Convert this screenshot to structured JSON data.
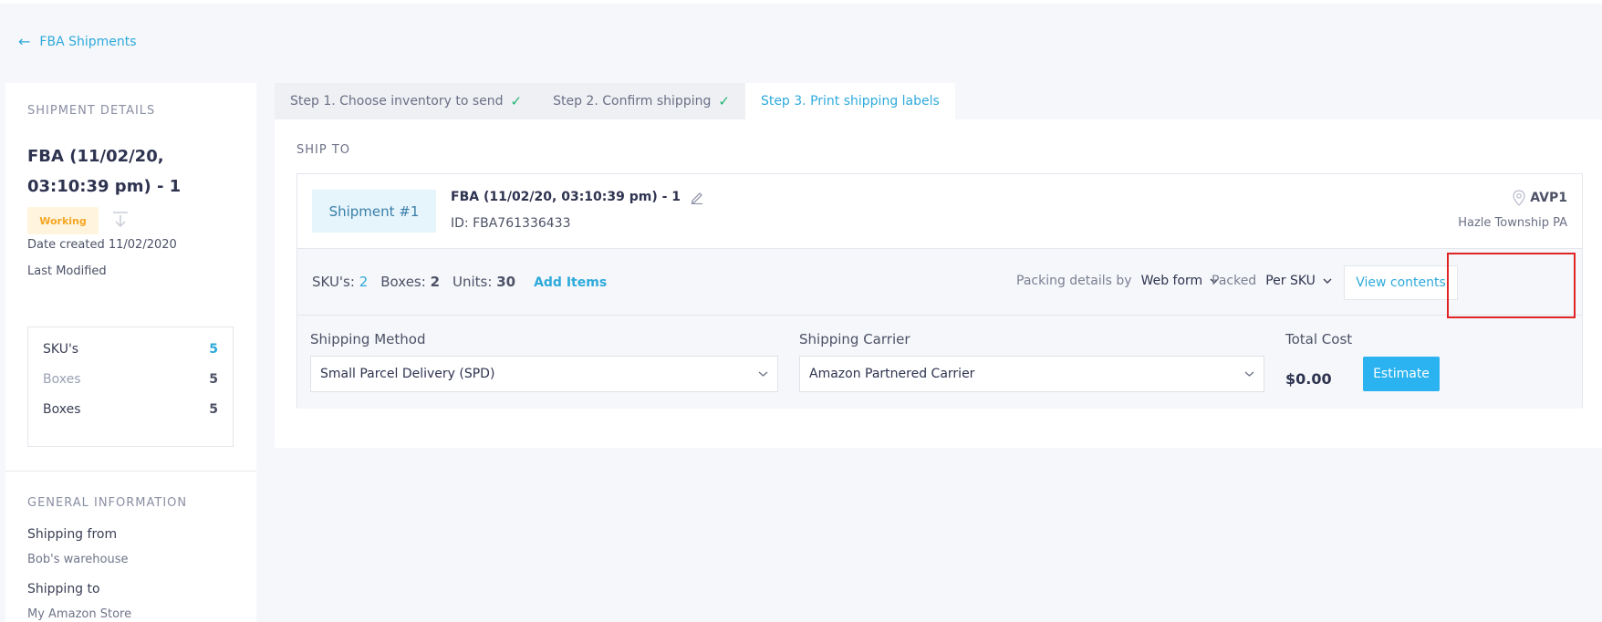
{
  "nav": {
    "back_label": "FBA Shipments"
  },
  "sidebar": {
    "details_title": "SHIPMENT DETAILS",
    "shipment_name": "FBA (11/02/20, 03:10:39 pm) - 1",
    "status": "Working",
    "date_created": "Date created 11/02/2020",
    "last_modified": "Last Modified",
    "stats": [
      {
        "label": "SKU's",
        "value": "5"
      },
      {
        "label": "Boxes",
        "value": "5"
      },
      {
        "label": "Boxes",
        "value": "5"
      }
    ],
    "general_title": "GENERAL INFORMATION",
    "shipping_from_label": "Shipping from",
    "shipping_from_value": "Bob's warehouse",
    "shipping_to_label": "Shipping to",
    "shipping_to_value": "My Amazon Store"
  },
  "tabs": [
    {
      "label": "Step 1. Choose inventory to send",
      "check": "✓"
    },
    {
      "label": "Step 2. Confirm shipping",
      "check": "✓"
    },
    {
      "label": "Step 3. Print shipping labels",
      "check": ""
    }
  ],
  "main": {
    "ship_to_title": "SHIP TO",
    "shipment": {
      "pill": "Shipment #1",
      "name": "FBA (11/02/20, 03:10:39 pm) - 1",
      "id": "ID: FBA761336433",
      "destination_code": "AVP1",
      "destination_city": "Hazle Township PA"
    },
    "counts": {
      "skus_label": "SKU's:",
      "skus_value": "2",
      "boxes_label": "Boxes:",
      "boxes_value": "2",
      "units_label": "Units:",
      "units_value": "30",
      "add_items": "Add Items"
    },
    "packing": {
      "details_label": "Packing details by",
      "details_value": "Web form",
      "packed_label": "Packed",
      "packed_value": "Per SKU",
      "view_contents": "View contents"
    },
    "shipping": {
      "method_label": "Shipping Method",
      "method_value": "Small Parcel Delivery (SPD)",
      "carrier_label": "Shipping Carrier",
      "carrier_value": "Amazon Partnered Carrier",
      "total_label": "Total Cost",
      "total_value": "$0.00",
      "estimate": "Estimate"
    }
  },
  "colors": {
    "accent": "#2eaadc",
    "button": "#2ab3f0",
    "highlight": "#e02424",
    "status_bg": "#fff5df",
    "status_text": "#f5a623",
    "check": "#22b573"
  }
}
